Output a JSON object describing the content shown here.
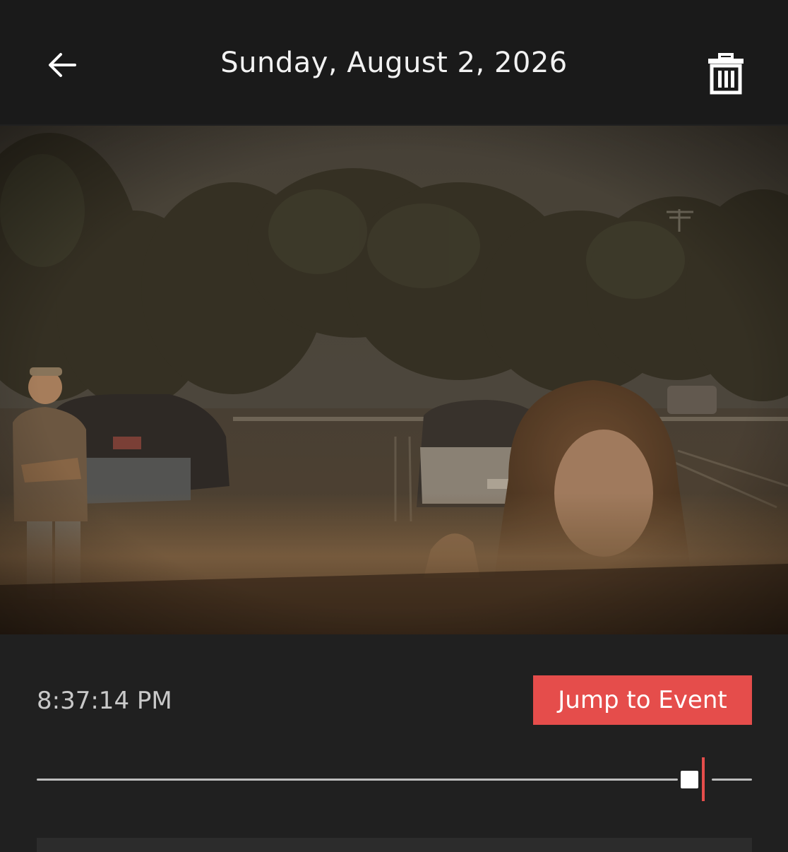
{
  "header": {
    "title": "Sunday, August 2, 2026",
    "back_icon": "arrow-left-icon",
    "delete_icon": "trash-icon"
  },
  "playback": {
    "timestamp": "8:37:14 PM",
    "jump_label": "Jump to Event",
    "position_fraction": 0.9,
    "event_fraction": 0.93
  },
  "colors": {
    "accent": "#e54d4b",
    "background": "#202020",
    "header_background": "#1a1a1a"
  }
}
